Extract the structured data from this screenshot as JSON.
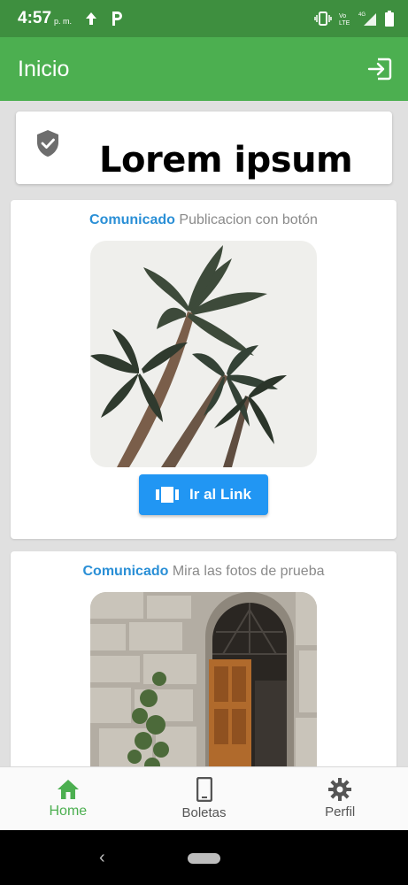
{
  "status_bar": {
    "time": "4:57",
    "ampm": "p. m."
  },
  "app_bar": {
    "title": "Inicio"
  },
  "banner": {
    "label": "Lorem ipsum"
  },
  "posts": [
    {
      "category": "Comunicado",
      "title": "Publicacion con botón",
      "button_label": "Ir al Link"
    },
    {
      "category": "Comunicado",
      "title": "Mira las fotos de prueba"
    }
  ],
  "bottom_nav": {
    "items": [
      {
        "label": "Home",
        "icon": "home-icon",
        "active": true
      },
      {
        "label": "Boletas",
        "icon": "phone-icon",
        "active": false
      },
      {
        "label": "Perfil",
        "icon": "gear-icon",
        "active": false
      }
    ]
  },
  "colors": {
    "status_bar": "#3e8f3f",
    "app_bar": "#4caf50",
    "accent_blue": "#2196f3",
    "category_blue": "#2a8fd6",
    "nav_active": "#4caf50"
  }
}
